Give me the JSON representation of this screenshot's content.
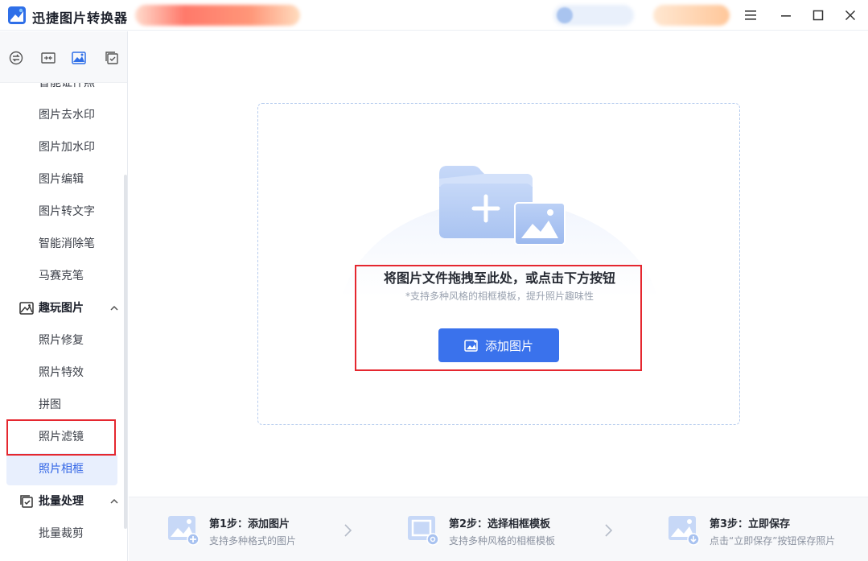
{
  "app": {
    "title": "迅捷图片转换器"
  },
  "colors": {
    "accent": "#3a72ec",
    "highlight": "#e5272f",
    "active_bg": "#e8effd"
  },
  "window_controls": [
    "menu-icon",
    "restore-icon",
    "maximize-icon",
    "close-icon"
  ],
  "sidebar": {
    "top_icons": [
      "convert-icon",
      "compress-icon",
      "image-icon",
      "batch-icon"
    ],
    "items_before": [
      {
        "label": "智能证件照"
      },
      {
        "label": "图片去水印"
      },
      {
        "label": "图片加水印"
      },
      {
        "label": "图片编辑"
      },
      {
        "label": "图片转文字"
      },
      {
        "label": "智能消除笔"
      },
      {
        "label": "马赛克笔"
      }
    ],
    "group_fun": {
      "label": "趣玩图片"
    },
    "fun_items": [
      {
        "label": "照片修复"
      },
      {
        "label": "照片特效"
      },
      {
        "label": "拼图"
      },
      {
        "label": "照片滤镜"
      },
      {
        "label": "照片相框",
        "active": true
      }
    ],
    "group_batch": {
      "label": "批量处理"
    },
    "batch_items": [
      {
        "label": "批量裁剪"
      }
    ]
  },
  "dropzone": {
    "title": "将图片文件拖拽至此处，或点击下方按钮",
    "subtitle": "*支持多种风格的相框模板，提升照片趣味性",
    "button_label": "添加图片"
  },
  "steps": [
    {
      "title": "第1步：添加图片",
      "desc": "支持多种格式的图片"
    },
    {
      "title": "第2步：选择相框模板",
      "desc": "支持多种风格的相框模板"
    },
    {
      "title": "第3步：立即保存",
      "desc": "点击“立即保存”按钮保存照片"
    }
  ]
}
